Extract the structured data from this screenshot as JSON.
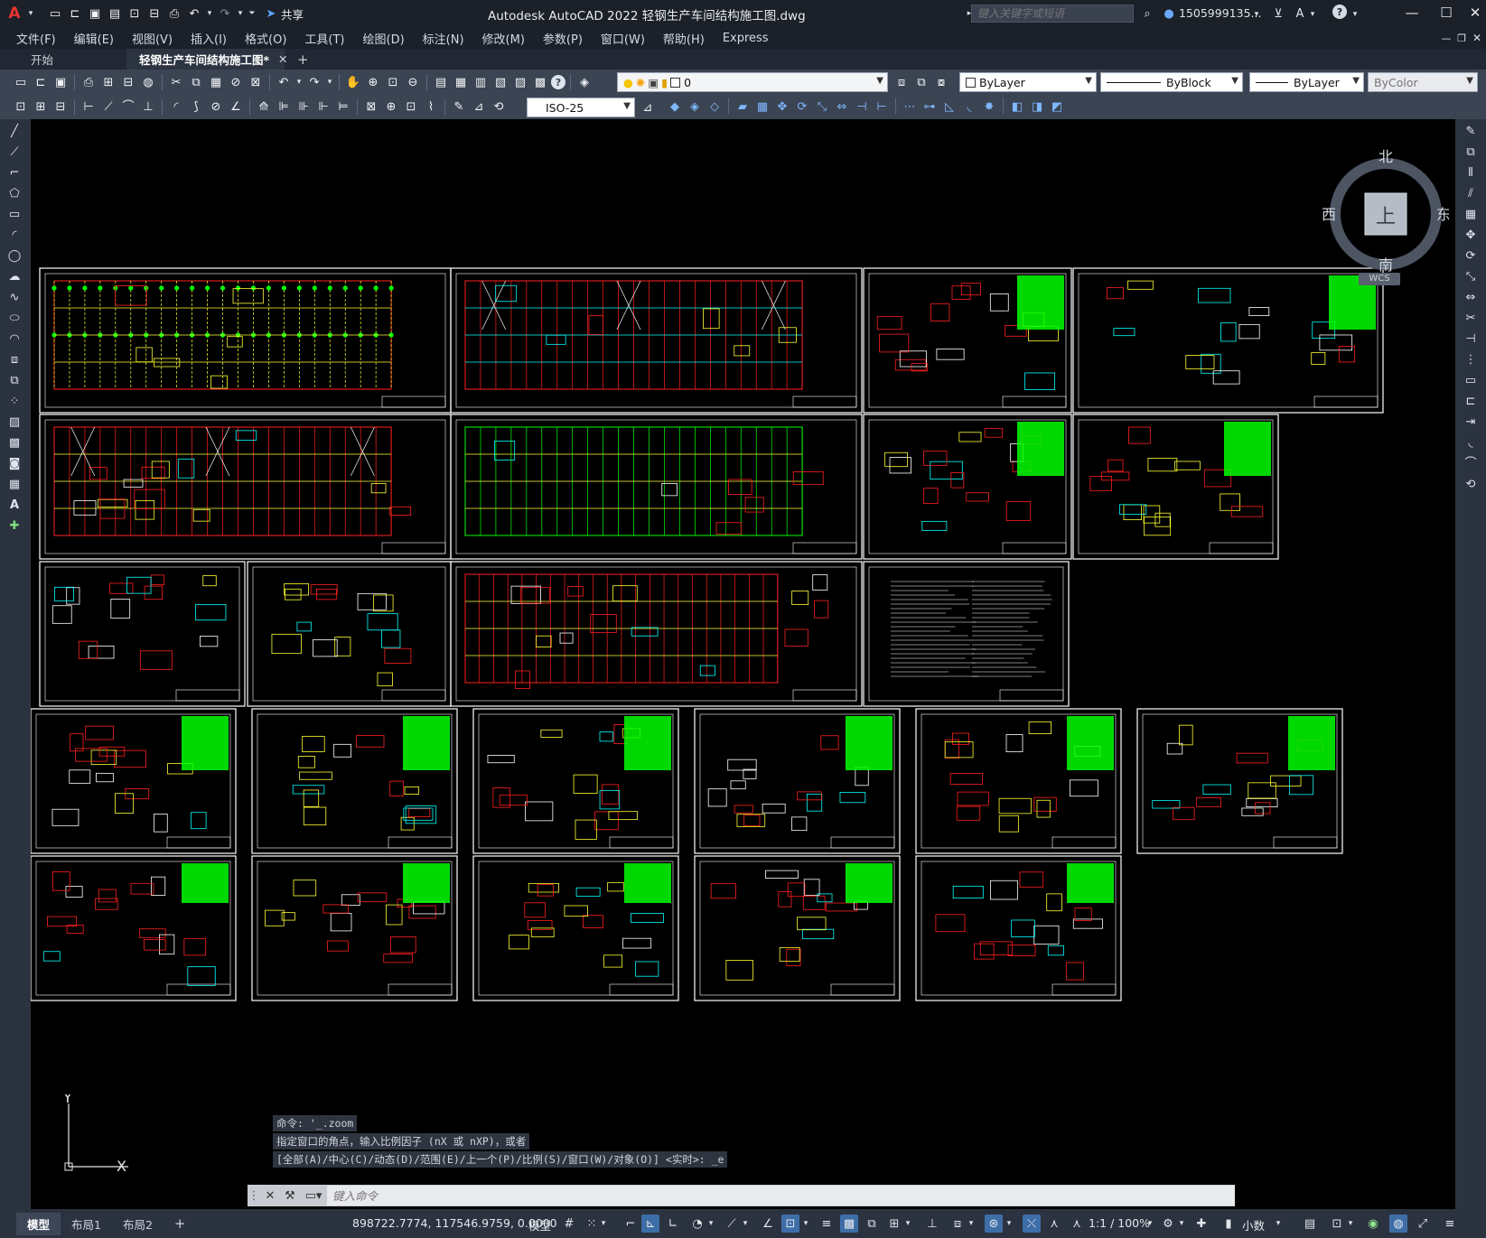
{
  "app": {
    "title": "Autodesk AutoCAD 2022    轻钢生产车间结构施工图.dwg",
    "share_label": "共享",
    "search_placeholder": "键入关键字或短语",
    "user": "1505999135..."
  },
  "menu": [
    "文件(F)",
    "编辑(E)",
    "视图(V)",
    "插入(I)",
    "格式(O)",
    "工具(T)",
    "绘图(D)",
    "标注(N)",
    "修改(M)",
    "参数(P)",
    "窗口(W)",
    "帮助(H)",
    "Express"
  ],
  "tabs": [
    {
      "label": "开始",
      "active": false
    },
    {
      "label": "轻钢生产车间结构施工图*",
      "active": true
    }
  ],
  "toolbar": {
    "layer_value": "0",
    "color_value": "ByLayer",
    "linetype_value": "ByBlock",
    "lineweight_value": "ByLayer",
    "plotstyle_value": "ByColor",
    "dimstyle_value": "ISO-25"
  },
  "viewcube": {
    "north": "北",
    "south": "南",
    "east": "东",
    "west": "西",
    "top": "上",
    "wcs": "WCS"
  },
  "ucs": {
    "x": "X",
    "y": "Y"
  },
  "command": {
    "history": [
      "命令: '_.zoom",
      "指定窗口的角点，输入比例因子 (nX 或 nXP)，或者",
      "[全部(A)/中心(C)/动态(D)/范围(E)/上一个(P)/比例(S)/窗口(W)/对象(O)] <实时>: _e"
    ],
    "input_placeholder": "键入命令"
  },
  "status": {
    "layout_tabs": [
      "模型",
      "布局1",
      "布局2"
    ],
    "coords": "898722.7774, 117546.9759, 0.0000",
    "model_label": "模型",
    "scale": "1:1 / 100%",
    "units": "小数"
  },
  "colors": {
    "canvas": "#000000",
    "frame": "#ffffff",
    "red": "#ff2020",
    "yellow": "#ffff33",
    "green": "#00ff00",
    "cyan": "#00ffff",
    "blue": "#3399ff"
  }
}
